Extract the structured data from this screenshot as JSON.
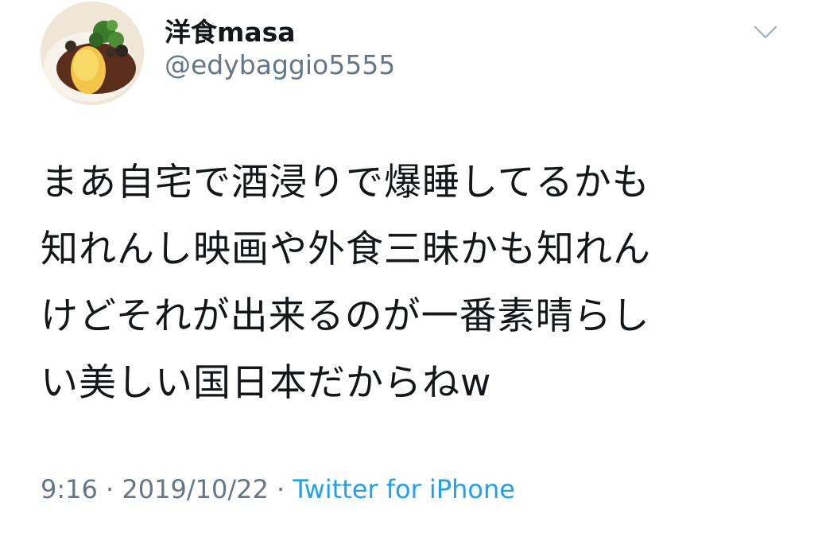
{
  "author": {
    "display_name": "洋食masa",
    "handle": "@edybaggio5555",
    "avatar_icon": "omelette-rice-photo"
  },
  "menu": {
    "icon": "chevron-down-icon"
  },
  "tweet": {
    "lines": [
      "まあ自宅で酒浸りで爆睡してるかも",
      "知れんし映画や外食三昧かも知れん",
      "けどそれが出来るのが一番素晴らし",
      "い美しい国日本だからねw"
    ]
  },
  "meta": {
    "time": "9:16",
    "separator": "·",
    "date": "2019/10/22",
    "source": "Twitter for iPhone"
  },
  "colors": {
    "text": "#14171a",
    "secondary": "#657786",
    "link": "#1da1f2"
  }
}
